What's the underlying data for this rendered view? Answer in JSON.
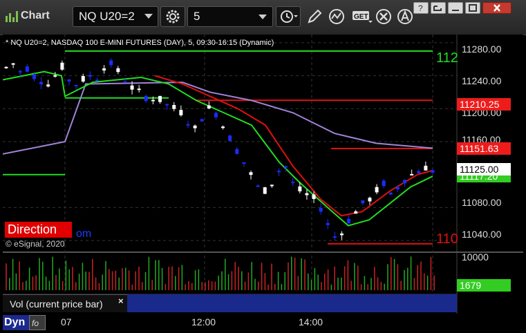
{
  "app": {
    "title": "Chart"
  },
  "toolbar": {
    "symbol": "NQ U20=2",
    "interval": "5"
  },
  "chart": {
    "description": "* NQ U20=2, NASDAQ 100 E-MINI FUTURES (DAY), 5, 09:30-16:15 (Dynamic)",
    "y_ticks": [
      "11280.00",
      "11240.00",
      "11200.00",
      "11160.00",
      "11080.00",
      "11040.00"
    ],
    "price_labels": {
      "upper_band": "11210.25",
      "lower_band": "11151.63",
      "last": "11125.00",
      "support": "11117.20"
    },
    "right_edge_labels": {
      "top": "112",
      "bottom": "110"
    },
    "overlay_label": "Direction",
    "overlay_suffix": "om",
    "copyright": "© eSignal, 2020"
  },
  "volume": {
    "y_tick": "10000",
    "current": "1679",
    "legend": "Vol (current price bar)",
    "close_glyph": "×"
  },
  "x_axis": {
    "ticks": [
      "07",
      "12:00",
      "14:00"
    ]
  },
  "bottom": {
    "dyn_label": "Dyn"
  },
  "colors": {
    "up_bar": "#ffffff",
    "down_bar": "#1a2cff",
    "green_line": "#22dd22",
    "red_line": "#e01010",
    "purple_line": "#a283d8",
    "volume_green": "#22aa22",
    "volume_red": "#cc2222"
  },
  "chart_data": {
    "type": "candlestick",
    "title": "* NQ U20=2, NASDAQ 100 E-MINI FUTURES (DAY), 5, 09:30-16:15 (Dynamic)",
    "y_range": [
      11030,
      11290
    ],
    "ticks_y": [
      11280,
      11240,
      11200,
      11160,
      11080,
      11040
    ],
    "last_price": 11125.0,
    "levels": {
      "upper_green": 11270,
      "mid_green": 11213,
      "red_upper": 11210.25,
      "red_lower": 11151.63,
      "green_left": 11120,
      "red_bottom": 11036
    },
    "volume_axis_max": 10000,
    "current_volume": 1679
  }
}
